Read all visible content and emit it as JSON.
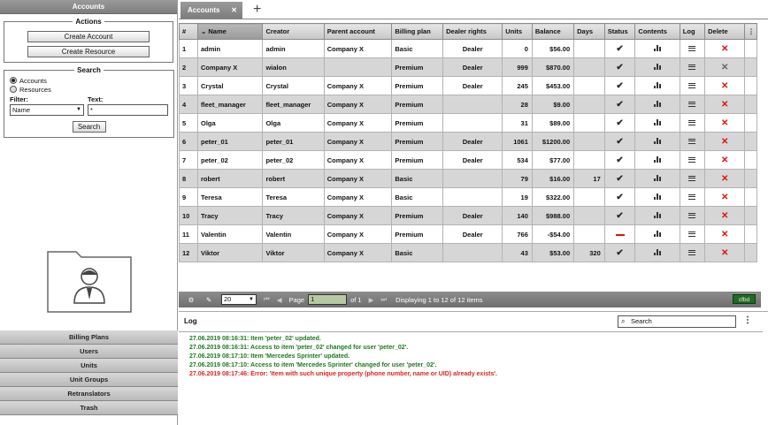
{
  "left": {
    "header": "Accounts",
    "actions": {
      "title": "Actions",
      "create_account": "Create Account",
      "create_resource": "Create Resource"
    },
    "search": {
      "title": "Search",
      "radio_accounts": "Accounts",
      "radio_resources": "Resources",
      "filter_label": "Filter:",
      "text_label": "Text:",
      "filter_value": "Name",
      "text_value": "*",
      "button": "Search"
    },
    "nav": [
      "Billing Plans",
      "Users",
      "Units",
      "Unit Groups",
      "Retranslators",
      "Trash"
    ]
  },
  "tabs": {
    "active": "Accounts",
    "close": "✕",
    "add": "+"
  },
  "table": {
    "columns": [
      "#",
      "Name",
      "Creator",
      "Parent account",
      "Billing plan",
      "Dealer rights",
      "Units",
      "Balance",
      "Days",
      "Status",
      "Contents",
      "Log",
      "Delete"
    ],
    "sort_arrow": "⌄",
    "menu": "⋮",
    "rows": [
      {
        "n": "1",
        "name": "admin",
        "creator": "admin",
        "parent": "Company X",
        "plan": "Basic",
        "dealer": "Dealer",
        "units": "0",
        "balance": "$56.00",
        "days": "",
        "status": "ok",
        "delete": "red"
      },
      {
        "n": "2",
        "name": "Company X",
        "creator": "wialon",
        "parent": "",
        "plan": "Premium",
        "dealer": "Dealer",
        "units": "999",
        "balance": "$870.00",
        "days": "",
        "status": "ok",
        "delete": "gray"
      },
      {
        "n": "3",
        "name": "Crystal",
        "creator": "Crystal",
        "parent": "Company X",
        "plan": "Premium",
        "dealer": "Dealer",
        "units": "245",
        "balance": "$453.00",
        "days": "",
        "status": "ok",
        "delete": "red"
      },
      {
        "n": "4",
        "name": "fleet_manager",
        "creator": "fleet_manager",
        "parent": "Company X",
        "plan": "Premium",
        "dealer": "",
        "units": "28",
        "balance": "$9.00",
        "days": "",
        "status": "ok",
        "delete": "red"
      },
      {
        "n": "5",
        "name": "Olga",
        "creator": "Olga",
        "parent": "Company X",
        "plan": "Premium",
        "dealer": "",
        "units": "31",
        "balance": "$89.00",
        "days": "",
        "status": "ok",
        "delete": "red"
      },
      {
        "n": "6",
        "name": "peter_01",
        "creator": "peter_01",
        "parent": "Company X",
        "plan": "Premium",
        "dealer": "Dealer",
        "units": "1061",
        "balance": "$1200.00",
        "days": "",
        "status": "ok",
        "delete": "red"
      },
      {
        "n": "7",
        "name": "peter_02",
        "creator": "peter_02",
        "parent": "Company X",
        "plan": "Premium",
        "dealer": "Dealer",
        "units": "534",
        "balance": "$77.00",
        "days": "",
        "status": "ok",
        "delete": "red"
      },
      {
        "n": "8",
        "name": "robert",
        "creator": "robert",
        "parent": "Company X",
        "plan": "Basic",
        "dealer": "",
        "units": "79",
        "balance": "$16.00",
        "days": "17",
        "status": "ok",
        "delete": "red"
      },
      {
        "n": "9",
        "name": "Teresa",
        "creator": "Teresa",
        "parent": "Company X",
        "plan": "Basic",
        "dealer": "",
        "units": "19",
        "balance": "$322.00",
        "days": "",
        "status": "ok",
        "delete": "red"
      },
      {
        "n": "10",
        "name": "Tracy",
        "creator": "Tracy",
        "parent": "Company X",
        "plan": "Premium",
        "dealer": "Dealer",
        "units": "140",
        "balance": "$988.00",
        "days": "",
        "status": "ok",
        "delete": "red"
      },
      {
        "n": "11",
        "name": "Valentin",
        "creator": "Valentin",
        "parent": "Company X",
        "plan": "Premium",
        "dealer": "Dealer",
        "units": "766",
        "balance": "-$54.00",
        "days": "",
        "status": "blocked",
        "delete": "red"
      },
      {
        "n": "12",
        "name": "Viktor",
        "creator": "Viktor",
        "parent": "Company X",
        "plan": "Basic",
        "dealer": "",
        "units": "43",
        "balance": "$53.00",
        "days": "320",
        "status": "ok",
        "delete": "red"
      }
    ]
  },
  "pager": {
    "page_size": "20",
    "page_label": "Page",
    "page_value": "1",
    "of_label": "of 1",
    "display": "Displaying 1 to 12 of 12 items",
    "badge": "cfbd"
  },
  "log": {
    "title": "Log",
    "search_placeholder": "Search",
    "menu": "⋮",
    "lines": [
      {
        "text": "27.06.2019 08:16:31: Item 'peter_02' updated.",
        "color": "#1d7a1d"
      },
      {
        "text": "27.06.2019 08:16:31: Access to item 'peter_02' changed for user 'peter_02'.",
        "color": "#1d7a1d"
      },
      {
        "text": "27.06.2019 08:17:10: Item 'Mercedes Sprinter' updated.",
        "color": "#1d7a1d"
      },
      {
        "text": "27.06.2019 08:17:10: Access to item 'Mercedes Sprinter' changed for user 'peter_02'.",
        "color": "#1d7a1d"
      },
      {
        "text": "27.06.2019 08:17:46: Error: 'Item with such unique property (phone number, name or UID) already exists'.",
        "color": "#e02020"
      }
    ]
  },
  "colors": {
    "accent_dark": "#7d7d7d",
    "badge": "#1f6b25",
    "delete_red": "#d11111",
    "log_green": "#1d7a1d",
    "log_red": "#e02020"
  },
  "icons": {
    "status_ok": "check-icon",
    "status_blocked": "blocked-dash-icon",
    "contents": "bar-chart-icon",
    "log": "list-lines-icon",
    "delete": "delete-x-icon"
  }
}
